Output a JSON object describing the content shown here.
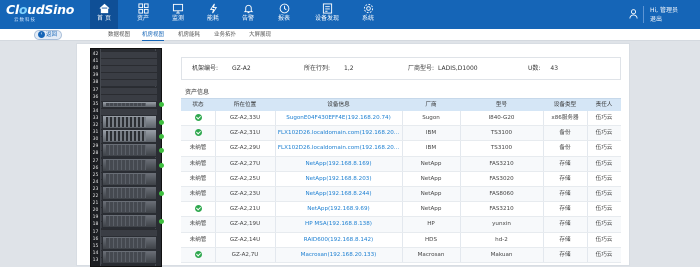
{
  "app": {
    "logo_text_a": "Cl",
    "logo_text_o": "o",
    "logo_text_b": "udSino",
    "logo_sub": "云数科技"
  },
  "nav": [
    {
      "label": "首 页",
      "icon": "home-icon",
      "active": true
    },
    {
      "label": "资产",
      "icon": "grid-icon"
    },
    {
      "label": "监测",
      "icon": "monitor-icon"
    },
    {
      "label": "能耗",
      "icon": "bolt-icon"
    },
    {
      "label": "告警",
      "icon": "bell-icon"
    },
    {
      "label": "报表",
      "icon": "clock-icon"
    },
    {
      "label": "设备发现",
      "icon": "device-icon"
    },
    {
      "label": "系统",
      "icon": "gear-icon"
    }
  ],
  "user": {
    "greeting": "Hi, 管理员",
    "logout": "退出"
  },
  "subnav": {
    "back": "返回",
    "tabs": [
      "数据视图",
      "机房视图",
      "机房能耗",
      "业务拓扑",
      "大屏展现"
    ],
    "active_index": 1
  },
  "rack": {
    "unit_labels": [
      "42",
      "41",
      "40",
      "39",
      "38",
      "37",
      "36",
      "35",
      "34",
      "33",
      "32",
      "31",
      "30",
      "29",
      "28",
      "27",
      "26",
      "25",
      "24",
      "23",
      "22",
      "21",
      "20",
      "19",
      "18",
      "17",
      "16",
      "15",
      "14",
      "13"
    ]
  },
  "info": {
    "cabinet_label": "机架编号:",
    "cabinet_value": "GZ-A2",
    "row_label": "所在行列:",
    "row_value": "1,2",
    "vendor_label": "厂商型号:",
    "vendor_value": "LADIS,D1000",
    "u_label": "U数:",
    "u_value": "43"
  },
  "section_title": "资产信息",
  "table": {
    "columns": [
      "状态",
      "所在位置",
      "设备信息",
      "厂商",
      "型号",
      "设备类型",
      "责任人"
    ],
    "rows": [
      {
        "status": "ok",
        "status_text": "",
        "location": "GZ-A2,33U",
        "device": "SugonE04F430EFF4E(192.168.20.74)",
        "vendor": "Sugon",
        "model": "I840-G20",
        "type": "x86服务器",
        "owner": "伍巧云"
      },
      {
        "status": "ok",
        "status_text": "",
        "location": "GZ-A2,31U",
        "device": "FLX102D26.localdomain.com(192.168.20...",
        "vendor": "IBM",
        "model": "TS3100",
        "type": "备份",
        "owner": "伍巧云"
      },
      {
        "status": "text",
        "status_text": "未纳管",
        "location": "GZ-A2,29U",
        "device": "FLX102D26.localdomain.com(192.168.20...",
        "vendor": "IBM",
        "model": "TS3100",
        "type": "备份",
        "owner": "伍巧云"
      },
      {
        "status": "text",
        "status_text": "未纳管",
        "location": "GZ-A2,27U",
        "device": "NetApp(192.168.8.169)",
        "vendor": "NetApp",
        "model": "FAS3210",
        "type": "存储",
        "owner": "伍巧云"
      },
      {
        "status": "text",
        "status_text": "未纳管",
        "location": "GZ-A2,25U",
        "device": "NetApp(192.168.8.203)",
        "vendor": "NetApp",
        "model": "FAS3020",
        "type": "存储",
        "owner": "伍巧云"
      },
      {
        "status": "text",
        "status_text": "未纳管",
        "location": "GZ-A2,23U",
        "device": "NetApp(192.168.8.244)",
        "vendor": "NetApp",
        "model": "FAS8060",
        "type": "存储",
        "owner": "伍巧云"
      },
      {
        "status": "ok",
        "status_text": "",
        "location": "GZ-A2,21U",
        "device": "NetApp(192.168.9.69)",
        "vendor": "NetApp",
        "model": "FAS3210",
        "type": "存储",
        "owner": "伍巧云"
      },
      {
        "status": "text",
        "status_text": "未纳管",
        "location": "GZ-A2,19U",
        "device": "HP MSA(192.168.8.138)",
        "vendor": "HP",
        "model": "yunxin",
        "type": "存储",
        "owner": "伍巧云"
      },
      {
        "status": "text",
        "status_text": "未纳管",
        "location": "GZ-A2,14U",
        "device": "RAID600(192.168.8.142)",
        "vendor": "HDS",
        "model": "hd-2",
        "type": "存储",
        "owner": "伍巧云"
      },
      {
        "status": "ok",
        "status_text": "",
        "location": "GZ-A2,7U",
        "device": "Macrosan(192.168.20.133)",
        "vendor": "Macrosan",
        "model": "Makuan",
        "type": "存储",
        "owner": "伍巧云"
      }
    ]
  },
  "colors": {
    "brand": "#1565b7",
    "ok": "#2fa84f",
    "link": "#1a7ed1"
  }
}
